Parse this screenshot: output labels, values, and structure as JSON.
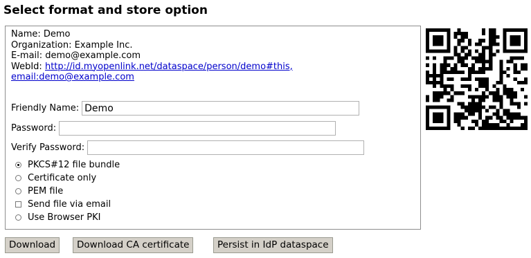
{
  "page": {
    "title": "Select format and store option"
  },
  "info": {
    "name": "Name: Demo",
    "organization": "Organization: Example Inc.",
    "email": "E-mail: demo@example.com",
    "webid_label": "WebId:",
    "webid_link": "http://id.myopenlink.net/dataspace/person/demo#this,",
    "email_link": "email:demo@example.com"
  },
  "form": {
    "friendly_name_label": "Friendly Name:",
    "friendly_name_value": "Demo",
    "password_label": "Password:",
    "password_value": "",
    "verify_password_label": "Verify Password:",
    "verify_password_value": ""
  },
  "options": [
    {
      "label": "PKCS#12 file bundle",
      "type": "radio",
      "checked": true
    },
    {
      "label": "Certificate only",
      "type": "radio",
      "checked": false
    },
    {
      "label": "PEM file",
      "type": "radio",
      "checked": false
    },
    {
      "label": "Send file via email",
      "type": "checkbox",
      "checked": false
    },
    {
      "label": "Use Browser PKI",
      "type": "radio",
      "checked": false
    }
  ],
  "buttons": {
    "download": "Download",
    "download_ca": "Download CA certificate",
    "persist": "Persist in IdP dataspace"
  },
  "qr": {
    "icon": "qr-code-icon",
    "color": "#000000"
  }
}
